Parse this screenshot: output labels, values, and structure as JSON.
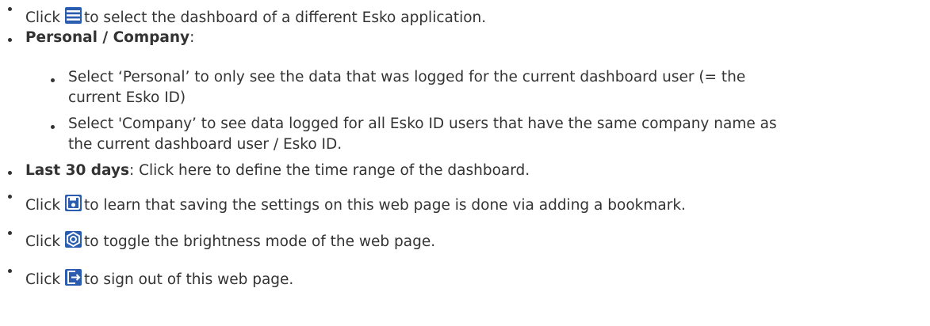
{
  "items": [
    {
      "pre": "Click",
      "post": "to select the dashboard of a different Esko application.",
      "icon": "hamburger-menu-icon"
    },
    {
      "bold": "Personal / Company",
      "rest": ":"
    },
    {
      "sub": [
        {
          "line1": "Select ‘Personal’ to only see the data that was logged for the current dashboard user (= the",
          "line2": "current Esko ID)"
        },
        {
          "line1": "Select 'Company’ to see data logged for all Esko ID users that have the same company name as",
          "line2": "the current dashboard user / Esko ID."
        }
      ]
    },
    {
      "bold": "Last 30 days",
      "rest": ": Click here to define the time range of the dashboard."
    },
    {
      "pre": "Click",
      "post": "to learn that saving the settings on this web page is done via adding a bookmark.",
      "icon": "save-disk-icon"
    },
    {
      "pre": "Click",
      "post": "to toggle the brightness mode of the web page.",
      "icon": "brightness-gear-icon"
    },
    {
      "pre": "Click",
      "post": "to sign out of this web page.",
      "icon": "sign-out-icon"
    }
  ],
  "colors": {
    "icon": "#2a5db0",
    "text": "#333333"
  }
}
